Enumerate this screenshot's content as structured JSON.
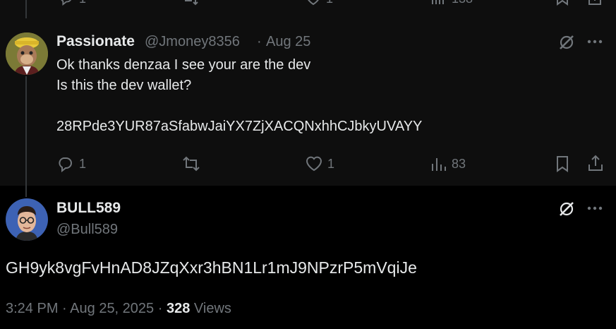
{
  "top_partial_row": {
    "reply_count": "1",
    "like_count": "1",
    "view_count": "138"
  },
  "reply": {
    "display_name": "Passionate",
    "handle": "@Jmoney8356",
    "separator": "·",
    "date": "Aug 25",
    "lines": [
      "Ok thanks denzaa I see your are the dev",
      "Is this the dev wallet?",
      "",
      "28RPde3YUR87aSfabwJaiYX7ZjXACQNxhhCJbkyUVAYY"
    ],
    "actions": {
      "reply_count": "1",
      "repost_count": "",
      "like_count": "1",
      "view_count": "83"
    },
    "icons": [
      "grok-icon",
      "more-icon",
      "reply-icon",
      "repost-icon",
      "like-icon",
      "views-icon",
      "bookmark-icon",
      "share-icon"
    ]
  },
  "main_post": {
    "display_name": "BULL589",
    "handle": "@Bull589",
    "text": "GH9yk8vgFvHnAD8JZqXxr3hBN1Lr1mJ9NPzrP5mVqiJe",
    "time": "3:24 PM",
    "sep1": "·",
    "date": "Aug 25, 2025",
    "sep2": "·",
    "views_count": "328",
    "views_label": "Views"
  },
  "colors": {
    "background": "#000000",
    "reply_background": "#0e0e0e",
    "text": "#e7e9ea",
    "muted": "#71767b"
  }
}
